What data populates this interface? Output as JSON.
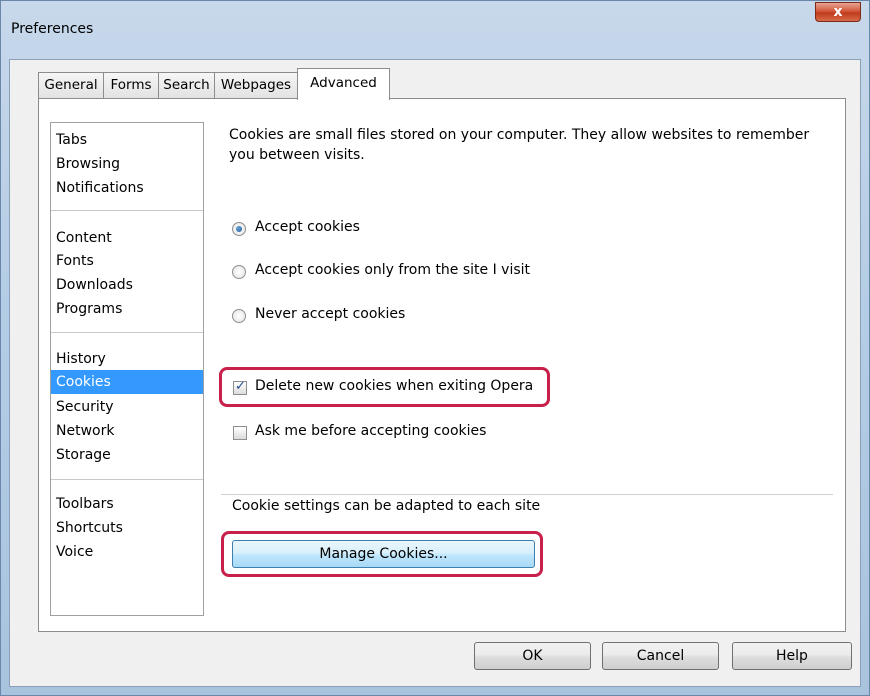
{
  "window": {
    "title": "Preferences",
    "close_glyph": "x"
  },
  "tabs": [
    {
      "label": "General"
    },
    {
      "label": "Forms"
    },
    {
      "label": "Search"
    },
    {
      "label": "Webpages"
    },
    {
      "label": "Advanced",
      "active": true
    }
  ],
  "sidebar": {
    "items": [
      {
        "label": "Tabs"
      },
      {
        "label": "Browsing"
      },
      {
        "label": "Notifications"
      },
      {
        "label": "Content"
      },
      {
        "label": "Fonts"
      },
      {
        "label": "Downloads"
      },
      {
        "label": "Programs"
      },
      {
        "label": "History"
      },
      {
        "label": "Cookies",
        "selected": true
      },
      {
        "label": "Security"
      },
      {
        "label": "Network"
      },
      {
        "label": "Storage"
      },
      {
        "label": "Toolbars"
      },
      {
        "label": "Shortcuts"
      },
      {
        "label": "Voice"
      }
    ]
  },
  "cookies": {
    "intro": "Cookies are small files stored on your computer. They allow websites to remember you between visits.",
    "radios": [
      {
        "label": "Accept cookies",
        "checked": true
      },
      {
        "label": "Accept cookies only from the site I visit",
        "checked": false
      },
      {
        "label": "Never accept cookies",
        "checked": false
      }
    ],
    "checkboxes": [
      {
        "label": "Delete new cookies when exiting Opera",
        "checked": true
      },
      {
        "label": "Ask me before accepting cookies",
        "checked": false
      }
    ],
    "site_settings_text": "Cookie settings can be adapted to each site",
    "manage_button": "Manage Cookies..."
  },
  "footer": {
    "ok": "OK",
    "cancel": "Cancel",
    "help": "Help"
  },
  "colors": {
    "highlight": "#c8204a",
    "selection": "#3399ff"
  }
}
